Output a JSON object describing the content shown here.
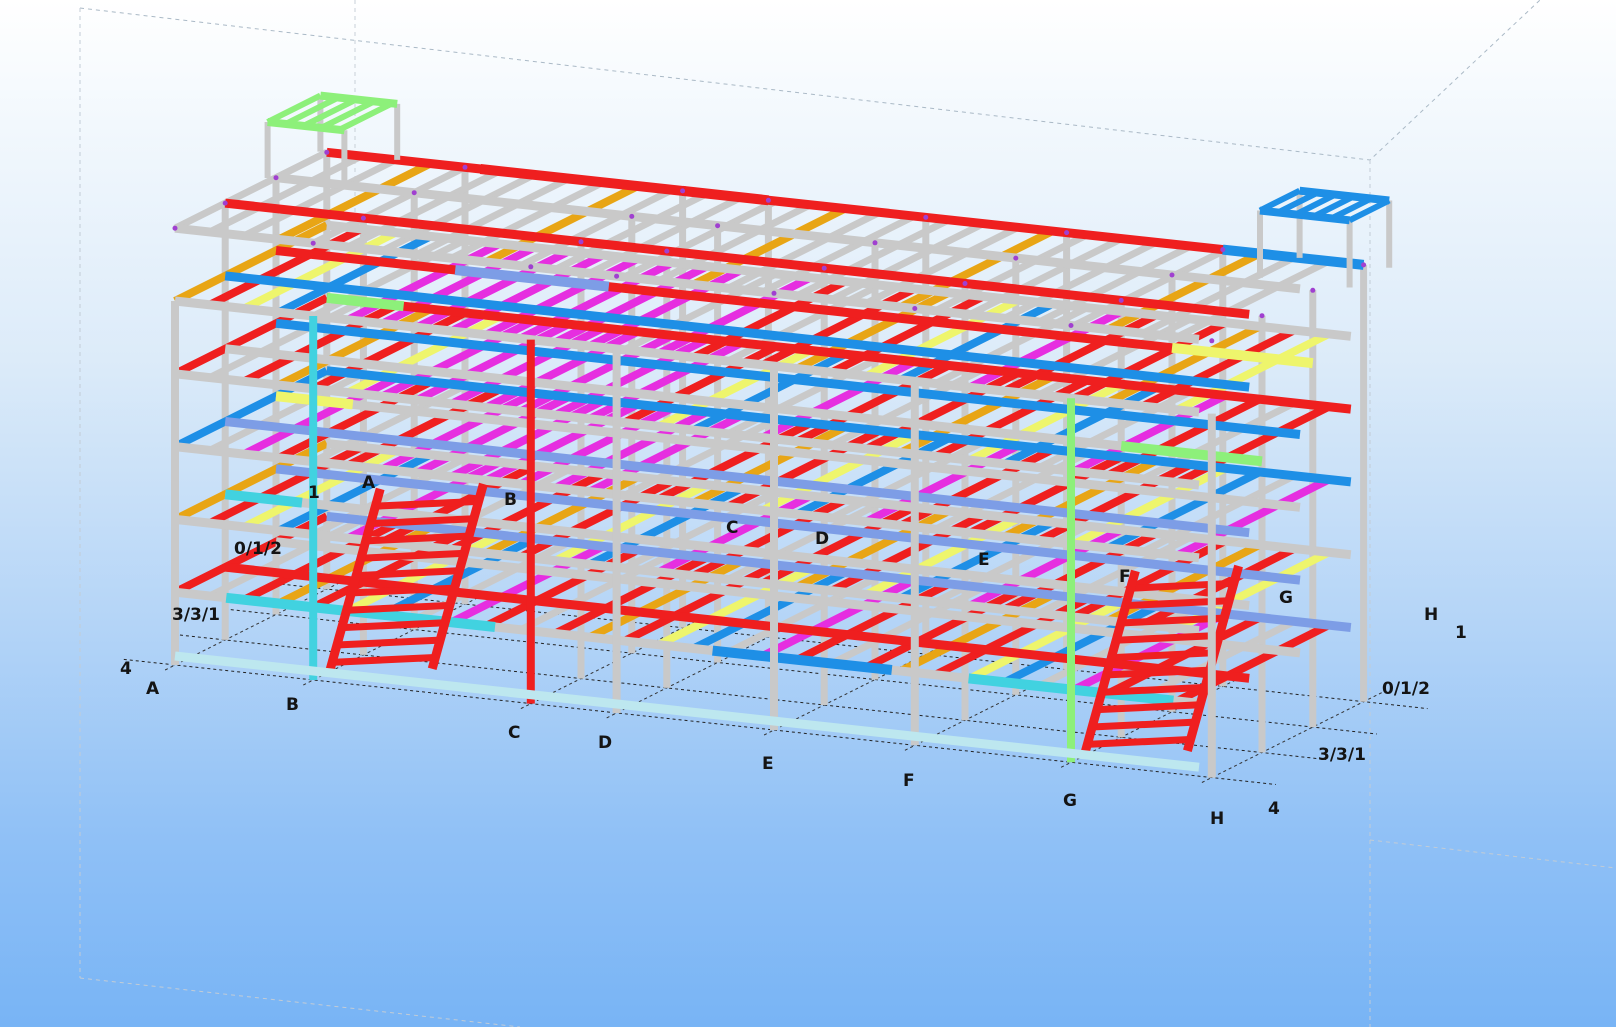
{
  "grid_labels_bottom": [
    "4",
    "A",
    "B",
    "C",
    "D",
    "E",
    "F",
    "G",
    "H",
    "4"
  ],
  "grid_labels_bottom_right": [
    "1",
    "0/1/2",
    "3/3/1"
  ],
  "grid_labels_left": [
    "3/3/1",
    "0/1/2",
    "1"
  ],
  "grid_labels_top": [
    "A",
    "B",
    "C",
    "D",
    "E",
    "F",
    "G",
    "H"
  ],
  "colors": {
    "column": "#c9c9c9",
    "beam_red": "#ef1f1f",
    "beam_magenta": "#e62ee0",
    "beam_orange": "#e8a515",
    "beam_yellow": "#eef56c",
    "beam_blue": "#1e8fe6",
    "beam_periwinkle": "#7d9de6",
    "beam_cyan": "#41d2e0",
    "beam_green": "#8df07a"
  }
}
